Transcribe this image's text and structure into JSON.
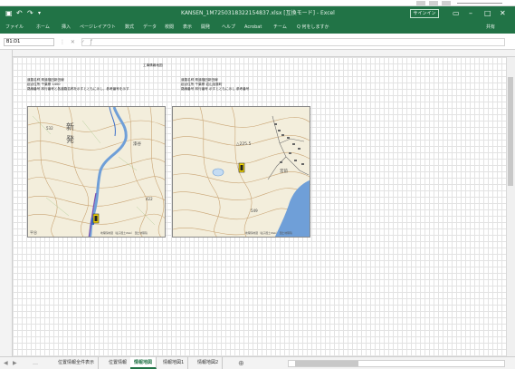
{
  "window": {
    "title": "KANSEN_1M7250318322154837.xlsx [互換モード] - Excel",
    "signin_label": "サインイン",
    "share_label": "共有"
  },
  "qat": {
    "save_icon": "save-icon",
    "undo_icon": "undo-icon",
    "redo_icon": "redo-icon",
    "customize_icon": "chevron-down-icon"
  },
  "ribbon": {
    "tabs": [
      "ファイル",
      "ホーム",
      "挿入",
      "ページレイアウト",
      "数式",
      "データ",
      "校閲",
      "表示",
      "開発",
      "ヘルプ",
      "Acrobat",
      "チーム",
      "Q 何をしますか"
    ]
  },
  "formula_bar": {
    "name_box": "B1:D1"
  },
  "sheet": {
    "heading": "工事情報地図",
    "left_block": [
      "道路名称 県道福田新田線",
      "起点住所 千葉県 1400",
      "路線番号 林行番号と各道路名称を示すとともに示し、参考番号を示す"
    ],
    "right_block": [
      "道路名称 県道福田新田線",
      "起点住所 千葉県 岩山加藤町",
      "路線番号 林行番号 示すとともに示し 参考番号"
    ],
    "map_left": {
      "labels": [
        "新",
        "発",
        "532",
        "漆谷",
        "422",
        "平谷"
      ],
      "credit": "地理院地図（電子国土Web） 国土地理院"
    },
    "map_right": {
      "labels": [
        "△225.5",
        "宮前",
        "549"
      ],
      "credit": "地理院地図（電子国土Web） 国土地理院"
    }
  },
  "sheet_tabs": {
    "items": [
      "位置情報全件表示",
      "位置情報",
      "情報地図",
      "情報地図1",
      "情報地図2"
    ],
    "active_index": 2,
    "add_label": "⊕"
  },
  "colors": {
    "excel_green": "#217346",
    "water_blue": "#6f9fd8",
    "map_bg": "#f3eedc",
    "contour": "#c9a474",
    "marker": "#f2d400"
  }
}
